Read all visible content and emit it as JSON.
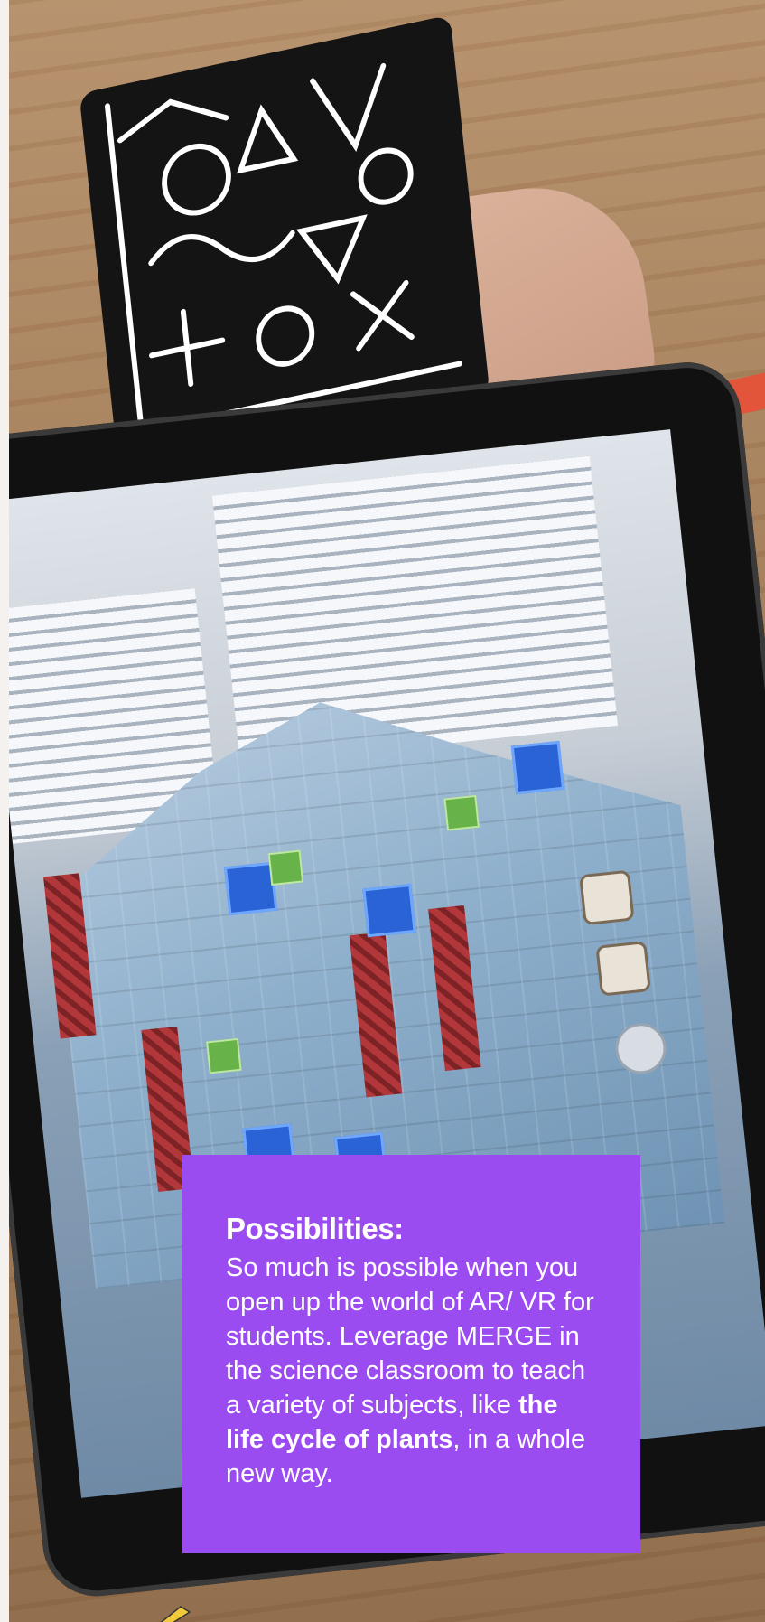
{
  "card": {
    "title": "Possibilities:",
    "body_before": "So much is possible when you open up the world of AR/ VR for students. Leverage MERGE in the science classroom to teach a variety of subjects, like ",
    "body_bold": "the life cycle of plants",
    "body_after": ", in a whole new way.",
    "background_color": "#9b4cf0",
    "text_color": "#ffffff"
  },
  "photo": {
    "icons": [
      "merge-cube-icon",
      "tablet-icon",
      "hand-icon",
      "settings-gear-icon",
      "add-block-icon"
    ]
  }
}
